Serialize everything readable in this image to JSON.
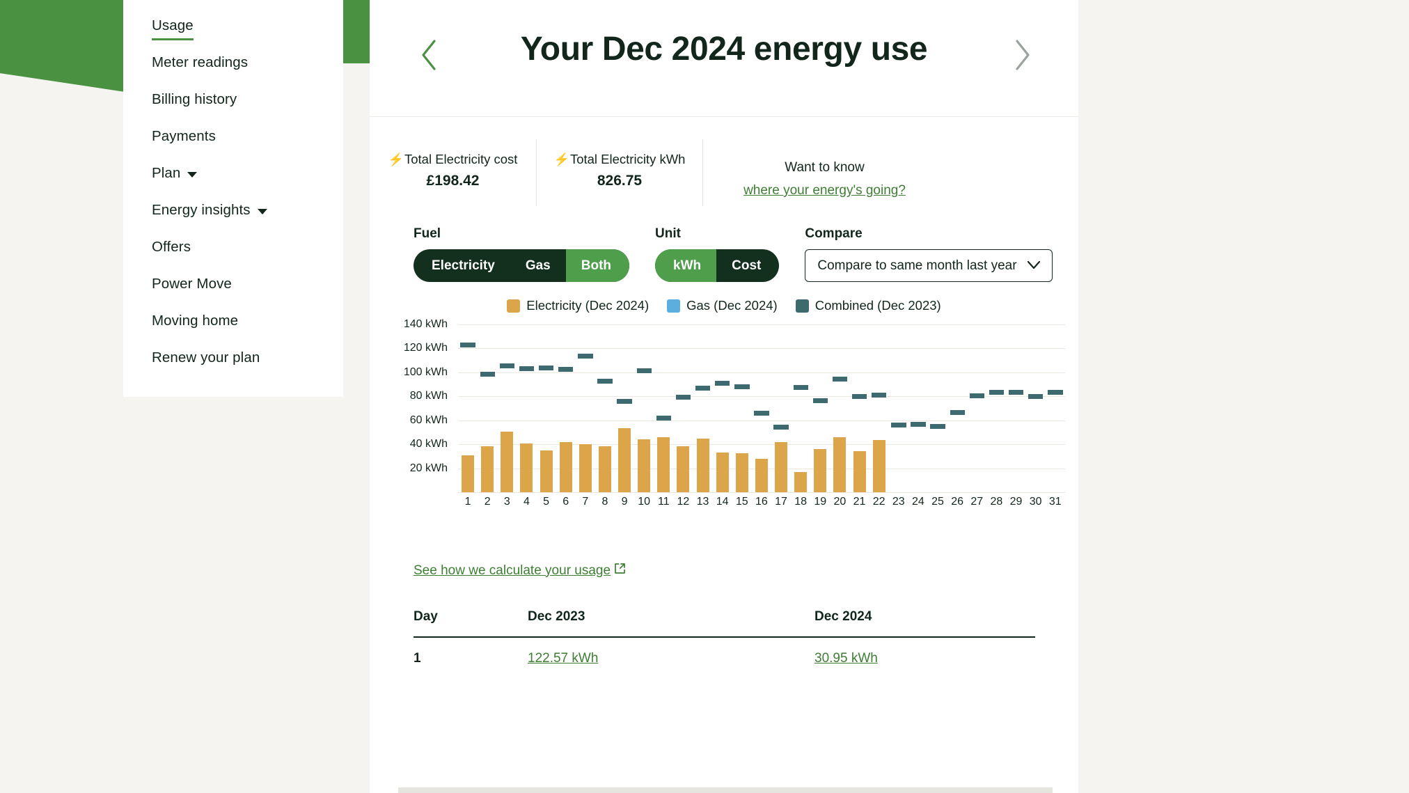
{
  "brand": {
    "green": "#4a9242",
    "dark_green": "#13301f",
    "accent_green": "#3e7e33"
  },
  "sidebar": {
    "items": [
      {
        "label": "Usage",
        "active": true,
        "caret": false
      },
      {
        "label": "Meter readings",
        "active": false,
        "caret": false
      },
      {
        "label": "Billing history",
        "active": false,
        "caret": false
      },
      {
        "label": "Payments",
        "active": false,
        "caret": false
      },
      {
        "label": "Plan",
        "active": false,
        "caret": true
      },
      {
        "label": "Energy insights",
        "active": false,
        "caret": true
      },
      {
        "label": "Offers",
        "active": false,
        "caret": false
      },
      {
        "label": "Power Move",
        "active": false,
        "caret": false
      },
      {
        "label": "Moving home",
        "active": false,
        "caret": false
      },
      {
        "label": "Renew your plan",
        "active": false,
        "caret": false
      }
    ]
  },
  "header": {
    "title": "Your Dec 2024 energy use",
    "prev_icon": "chevron-left-icon",
    "next_icon": "chevron-right-icon"
  },
  "stats": [
    {
      "icon": "lightning-bolt-icon",
      "label": "Total Electricity cost",
      "value": "£198.42"
    },
    {
      "icon": "lightning-bolt-icon",
      "label": "Total Electricity kWh",
      "value": "826.75"
    }
  ],
  "promo": {
    "line1": "Want to know",
    "link": "where your energy's going?"
  },
  "filters": {
    "fuel": {
      "label": "Fuel",
      "options": [
        "Electricity",
        "Gas",
        "Both"
      ],
      "selected": "Both"
    },
    "unit": {
      "label": "Unit",
      "options": [
        "kWh",
        "Cost"
      ],
      "selected": "kWh"
    },
    "compare": {
      "label": "Compare",
      "value": "Compare to same month last year",
      "chevron": "chevron-down-icon"
    }
  },
  "chart_data": {
    "type": "bar",
    "title": "",
    "xlabel": "",
    "ylabel": "kWh",
    "ylim": [
      0,
      145
    ],
    "grid": true,
    "legend_position": "top-center",
    "y_ticks": [
      "20 kWh",
      "40 kWh",
      "60 kWh",
      "80 kWh",
      "100 kWh",
      "120 kWh",
      "140 kWh"
    ],
    "y_tick_values": [
      20,
      40,
      60,
      80,
      100,
      120,
      140
    ],
    "categories": [
      "1",
      "2",
      "3",
      "4",
      "5",
      "6",
      "7",
      "8",
      "9",
      "10",
      "11",
      "12",
      "13",
      "14",
      "15",
      "16",
      "17",
      "18",
      "19",
      "20",
      "21",
      "22",
      "23",
      "24",
      "25",
      "26",
      "27",
      "28",
      "29",
      "30",
      "31"
    ],
    "series": [
      {
        "name": "Electricity (Dec 2024)",
        "color": "#dda54a",
        "render": "bar",
        "values": [
          30.95,
          38.5,
          50.2,
          40.4,
          35.0,
          41.5,
          39.8,
          38.0,
          53.5,
          44.3,
          45.8,
          38.2,
          44.8,
          33.0,
          32.5,
          28.0,
          42.0,
          17.0,
          36.0,
          45.6,
          34.5,
          43.5,
          null,
          null,
          null,
          null,
          null,
          null,
          null,
          null,
          null
        ]
      },
      {
        "name": "Gas (Dec 2024)",
        "color": "#5cade0",
        "render": "bar",
        "values": [
          null,
          null,
          null,
          null,
          null,
          null,
          null,
          null,
          null,
          null,
          null,
          null,
          null,
          null,
          null,
          null,
          null,
          null,
          null,
          null,
          null,
          null,
          null,
          null,
          null,
          null,
          null,
          null,
          null,
          null,
          null
        ]
      },
      {
        "name": "Combined (Dec 2023)",
        "color": "#3d6a6e",
        "render": "marker",
        "values": [
          122.57,
          98.5,
          105.5,
          103.0,
          103.5,
          102.5,
          113.5,
          92.5,
          75.5,
          101.5,
          62.0,
          79.0,
          86.5,
          90.5,
          88.0,
          66.0,
          54.0,
          87.5,
          76.0,
          94.5,
          79.5,
          81.0,
          56.0,
          56.5,
          55.0,
          66.5,
          80.5,
          83.0,
          83.5,
          80.0,
          83.0
        ]
      }
    ]
  },
  "legend": [
    {
      "label": "Electricity (Dec 2024)",
      "color": "#dda54a"
    },
    {
      "label": "Gas (Dec 2024)",
      "color": "#5cade0"
    },
    {
      "label": "Combined (Dec 2023)",
      "color": "#3d6a6e"
    }
  ],
  "calc_link": {
    "text": "See how we calculate your usage",
    "icon": "external-link-icon"
  },
  "table": {
    "headers": [
      "Day",
      "Dec 2023",
      "Dec 2024"
    ],
    "rows": [
      {
        "day": "1",
        "prev": "122.57 kWh",
        "cur": "30.95 kWh"
      }
    ]
  }
}
